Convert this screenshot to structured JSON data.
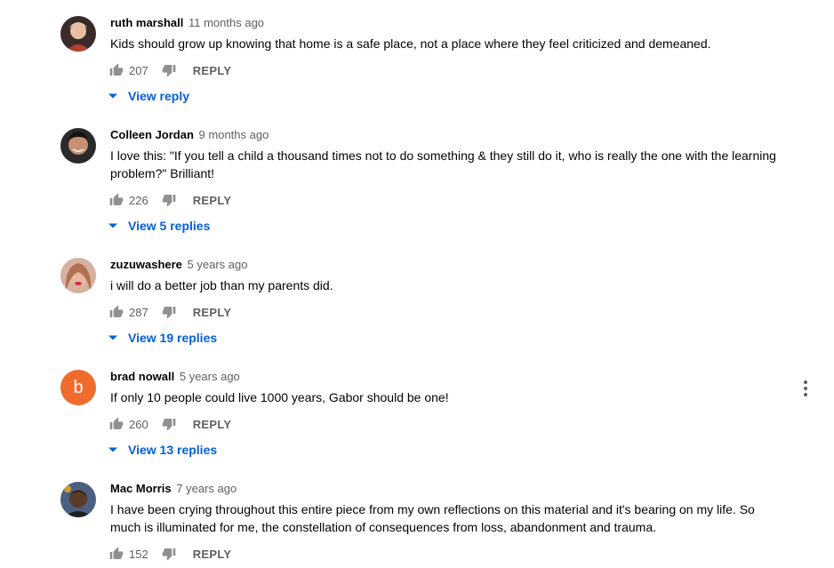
{
  "comments": [
    {
      "author": "ruth marshall",
      "time": "11 months ago",
      "text": "Kids should grow up knowing that home is a safe place, not a place where they feel criticized and demeaned.",
      "likes": "207",
      "reply_label": "REPLY",
      "view_replies": "View reply",
      "avatar_icon": "photo-avatar"
    },
    {
      "author": "Colleen Jordan",
      "time": "9 months ago",
      "text": "I love this: \"If you tell a child a thousand times not to do something & they still do it, who is really the one with the learning problem?\"  Brilliant!",
      "likes": "226",
      "reply_label": "REPLY",
      "view_replies": "View 5 replies",
      "avatar_icon": "photo-avatar"
    },
    {
      "author": "zuzuwashere",
      "time": "5 years ago",
      "text": "i will do a better job than my parents did.",
      "likes": "287",
      "reply_label": "REPLY",
      "view_replies": "View 19 replies",
      "avatar_icon": "photo-avatar"
    },
    {
      "author": "brad nowall",
      "time": "5 years ago",
      "text": "If only 10 people could live 1000 years, Gabor should be one!",
      "likes": "260",
      "reply_label": "REPLY",
      "view_replies": "View 13 replies",
      "avatar_letter": "b",
      "avatar_color": "#ef6c2e"
    },
    {
      "author": "Mac Morris",
      "time": "7 years ago",
      "text": "I have been crying throughout this entire piece from my own reflections on this material and it's bearing on my life. So much is illuminated for me, the constellation of consequences from loss, abandonment and trauma.",
      "likes": "152",
      "reply_label": "REPLY",
      "avatar_icon": "photo-avatar"
    }
  ],
  "colors": {
    "link": "#065fd4",
    "secondary_text": "#606060",
    "icon": "#909090"
  }
}
